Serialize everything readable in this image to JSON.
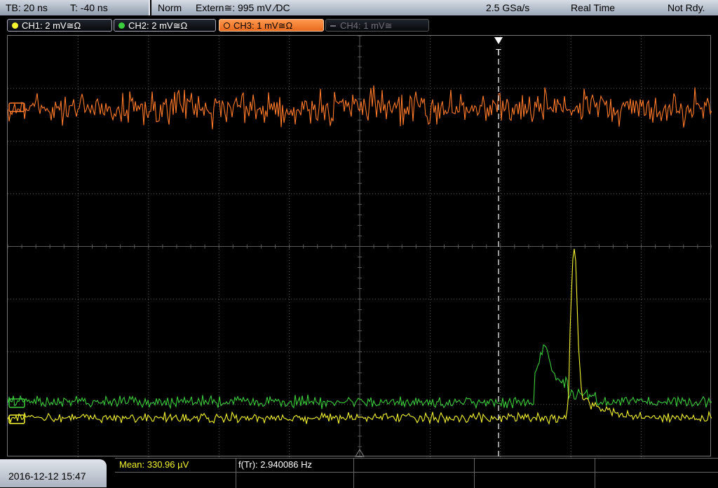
{
  "timebase": {
    "tb": "TB: 20 ns",
    "t": "T: -40 ns"
  },
  "acquisition": {
    "mode": "Norm",
    "trigger": "Extern≅: 995 mV ∕DC",
    "sample_rate": "2.5 GSa/s",
    "realtime": "Real Time",
    "status": "Not Rdy."
  },
  "channels": [
    {
      "label": "CH1: 2 mV≅Ω",
      "color": "#f5f532",
      "state": "on"
    },
    {
      "label": "CH2: 2 mV≅Ω",
      "color": "#3ccd3c",
      "state": "on"
    },
    {
      "label": "CH3: 1 mV≅Ω",
      "color": "#ff8c3a",
      "state": "active"
    },
    {
      "label": "CH4: 1 mV≅",
      "color": "#6d7078",
      "state": "off"
    }
  ],
  "datetime": "2016-12-12 15:47",
  "measurements": {
    "mean": "Mean: 330.96 µV",
    "freq": "f(Tr): 2.940086 Hz"
  },
  "trigger_marker": "T",
  "colors": {
    "ch1": "#f5f532",
    "ch2": "#3ccd3c",
    "ch3": "#ff7a2a",
    "grid": "#5a5a5a",
    "mean_text": "#f5f532"
  }
}
